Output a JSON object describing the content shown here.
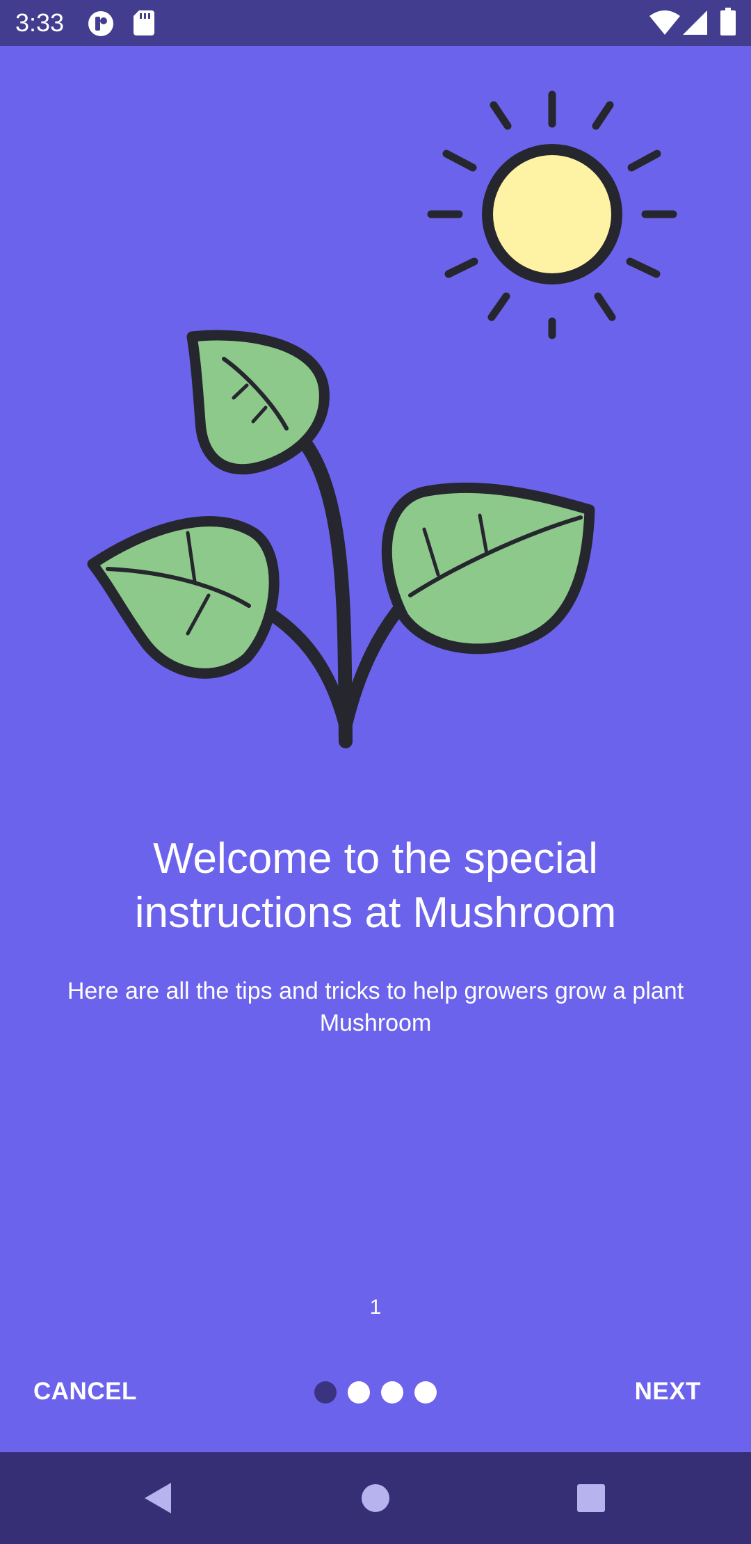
{
  "status_bar": {
    "time": "3:33",
    "icons": [
      "app-notification-icon",
      "sd-card-icon",
      "wifi-icon",
      "cell-signal-icon",
      "battery-icon"
    ]
  },
  "onboarding": {
    "illustration": [
      "sun-icon",
      "plant-leaves-icon"
    ],
    "title": "Welcome to the special instructions at Mushroom",
    "subtitle": "Here are all the tips and tricks to help growers grow a plant Mushroom",
    "page_number": "1"
  },
  "bottom_bar": {
    "cancel_label": "CANCEL",
    "next_label": "NEXT",
    "dots_total": 4,
    "active_dot": 1
  },
  "nav_bar": {
    "icons": [
      "back-icon",
      "home-icon",
      "recents-icon"
    ]
  },
  "colors": {
    "background": "#6C63EC",
    "status_bar": "#433D8F",
    "nav_bar": "#362F75",
    "active_dot": "#3A3480",
    "inactive_dot": "#FFFFFF",
    "sun_fill": "#FEF3A5",
    "leaf_fill": "#8DC98A",
    "outline": "#26262E"
  }
}
